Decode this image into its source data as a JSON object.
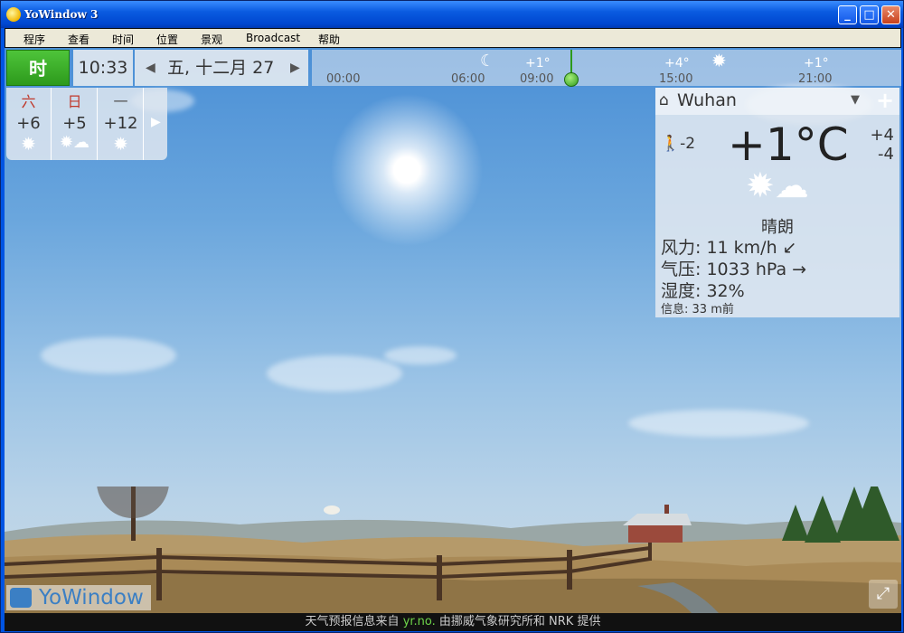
{
  "window": {
    "title": "YoWindow 3",
    "btn_min": "_",
    "btn_max": "□",
    "btn_close": "✕"
  },
  "menu": {
    "items": [
      "程序",
      "查看",
      "时间",
      "位置",
      "景观",
      "Broadcast",
      "帮助"
    ]
  },
  "topbar": {
    "hour_button": "时",
    "time": "10:33",
    "date": "五, 十二月 27",
    "timeline": {
      "hours": [
        "00:00",
        "06:00",
        "09:00",
        "15:00",
        "21:00"
      ],
      "temps": [
        "+1°",
        "+4°",
        "+1°"
      ]
    }
  },
  "forecast": {
    "days": [
      {
        "day": "六",
        "temp": "+6",
        "icon": "sun-icon"
      },
      {
        "day": "日",
        "temp": "+5",
        "icon": "sun-cloud-icon"
      },
      {
        "day": "一",
        "temp": "+12",
        "icon": "sun-icon"
      }
    ]
  },
  "location": {
    "city": "Wuhan",
    "temp": "+1°C",
    "feels_like": "-2",
    "high": "+4",
    "low": "-4",
    "condition": "晴朗",
    "wind_label": "风力:",
    "wind_value": "11 km/h ↙",
    "pressure_label": "气压:",
    "pressure_value": "1033 hPa →",
    "humidity_label": "湿度:",
    "humidity_value": "32%",
    "info_label": "信息:",
    "info_value": "33 m前"
  },
  "logo": {
    "text": "YoWindow"
  },
  "credits": {
    "prefix": "天气预报信息来自",
    "link": "yr.no.",
    "suffix": "由挪威气象研究所和 NRK 提供"
  },
  "colors": {
    "accent_green": "#2d9a1c",
    "sky": "#6aa6dd",
    "brand_blue": "#3b7fc4"
  }
}
